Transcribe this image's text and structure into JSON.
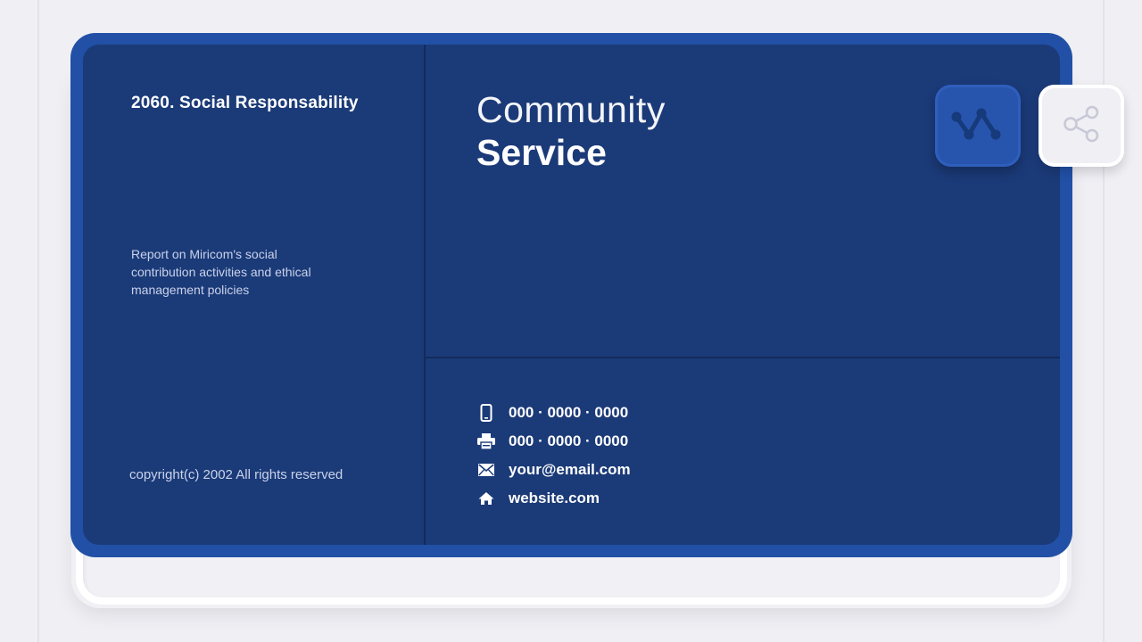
{
  "document": {
    "title": "2060. Social Responsability",
    "description": "Report on Miricom's social\ncontribution activities and ethical\nmanagement policies",
    "copyright": "copyright(c) 2002 All rights reserved"
  },
  "hero": {
    "line1": "Community",
    "line2": "Service"
  },
  "contact": {
    "items": [
      {
        "icon": "mobile-phone-icon",
        "text": "000 · 0000 · 0000"
      },
      {
        "icon": "fax-icon",
        "text": "000 · 0000 · 0000"
      },
      {
        "icon": "envelope-icon",
        "text": "your@email.com"
      },
      {
        "icon": "home-icon",
        "text": "website.com"
      }
    ]
  },
  "actions": {
    "chart_icon": "line-chart-icon",
    "share_icon": "share-icon"
  },
  "colors": {
    "card_frame": "#2150a6",
    "card_panel": "#1b3a78",
    "divider": "#122b5c",
    "chart_button": "#2754ad",
    "chart_glyph": "#163a7a",
    "share_glyph": "#c8c8d6",
    "background": "#efeff4"
  }
}
